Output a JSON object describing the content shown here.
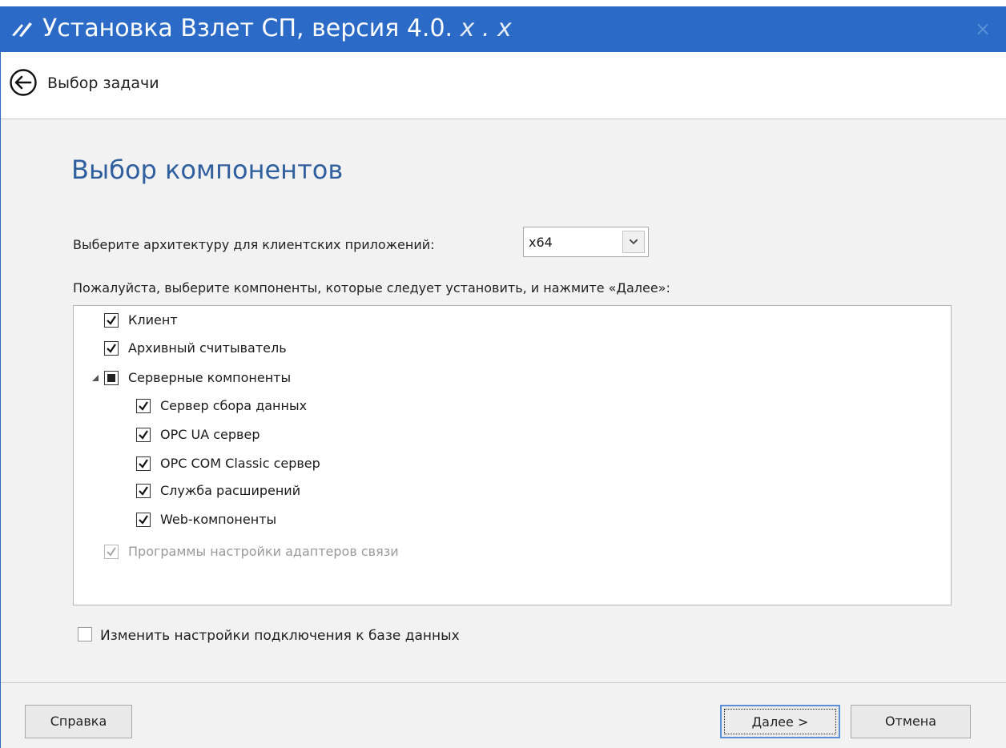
{
  "window": {
    "title_prefix": "Установка Взлет СП, версия 4.0.",
    "title_version": " x . x",
    "close_glyph": "×"
  },
  "nav": {
    "back_icon": "arrow-left-circle-icon",
    "title": "Выбор задачи"
  },
  "page": {
    "title": "Выбор компонентов",
    "arch_label": "Выберите архитектуру для клиентских приложений:",
    "arch_value": "x64",
    "components_label": "Пожалуйста, выберите компоненты, которые следует установить, и нажмите «Далее»:"
  },
  "components": [
    {
      "label": "Клиент",
      "state": "checked",
      "level": 0
    },
    {
      "label": "Архивный считыватель",
      "state": "checked",
      "level": 0
    },
    {
      "label": "Серверные компоненты",
      "state": "partial",
      "level": 0,
      "expanded": true
    },
    {
      "label": "Сервер сбора данных",
      "state": "checked",
      "level": 1
    },
    {
      "label": "OPC UA сервер",
      "state": "checked",
      "level": 1
    },
    {
      "label": "OPC COM Classic сервер",
      "state": "checked",
      "level": 1
    },
    {
      "label": "Служба расширений",
      "state": "checked",
      "level": 1
    },
    {
      "label": "Web-компоненты",
      "state": "checked",
      "level": 1
    },
    {
      "label": "Программы настройки адаптеров связи",
      "state": "checked-disabled",
      "level": 0
    }
  ],
  "db_settings": {
    "label": "Изменить настройки подключения к базе данных",
    "checked": false
  },
  "footer": {
    "help_label": "Справка",
    "next_label": "Далее >",
    "cancel_label": "Отмена"
  },
  "colors": {
    "titlebar": "#2b6bc7",
    "heading": "#2f5f9e"
  }
}
